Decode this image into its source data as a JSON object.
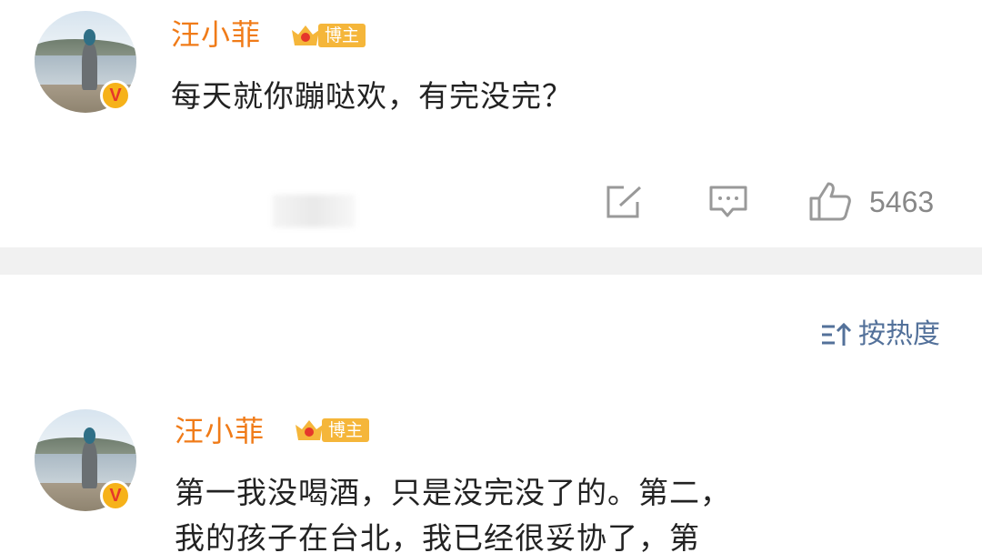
{
  "top_comment": {
    "username": "汪小菲",
    "badge_label": "博主",
    "text": "每天就你蹦哒欢，有完没完？",
    "like_count": "5463",
    "icons": [
      "repost-icon",
      "comment-icon",
      "like-icon"
    ]
  },
  "sort": {
    "label": "按热度",
    "icon": "sort-icon"
  },
  "reply": {
    "username": "汪小菲",
    "badge_label": "博主",
    "text_line1": "第一我没喝酒，只是没完没了的。第二，",
    "text_line2": "我的孩子在台北，我已经很妥协了，第"
  },
  "colors": {
    "username": "#f07b18",
    "badge": "#f5b63a",
    "sort": "#53719a",
    "separator": "#f1f1f1"
  }
}
